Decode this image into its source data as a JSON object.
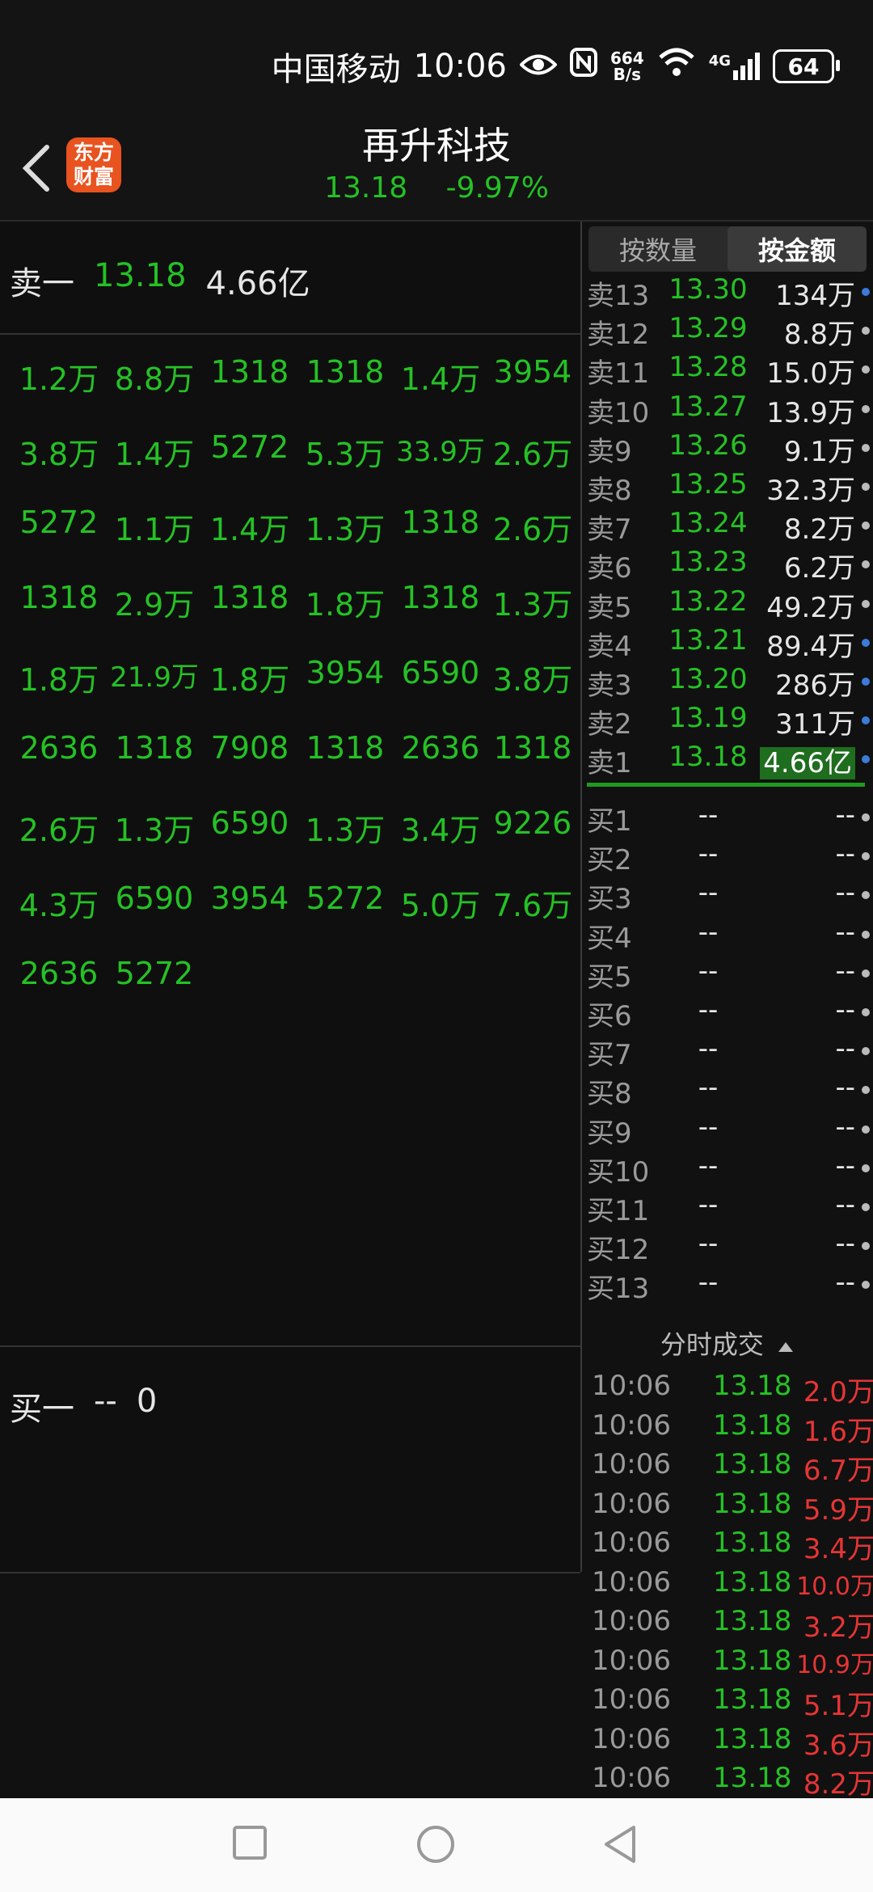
{
  "status": {
    "carrier": "中国移动",
    "time": "10:06",
    "net_speed_top": "664",
    "net_speed_bottom": "B/s",
    "signal": "4G",
    "battery": "64"
  },
  "header": {
    "title": "再升科技",
    "price": "13.18",
    "change": "-9.97%"
  },
  "sell1": {
    "label": "卖一",
    "price": "13.18",
    "amount": "4.66亿"
  },
  "buy1": {
    "label": "买一",
    "price": "--",
    "amount": "0"
  },
  "queue": [
    [
      "1.2万",
      "8.8万",
      "1318",
      "1318",
      "1.4万",
      "3954"
    ],
    [
      "3.8万",
      "1.4万",
      "5272",
      "5.3万",
      "33.9万",
      "2.6万"
    ],
    [
      "5272",
      "1.1万",
      "1.4万",
      "1.3万",
      "1318",
      "2.6万"
    ],
    [
      "1318",
      "2.9万",
      "1318",
      "1.8万",
      "1318",
      "1.3万"
    ],
    [
      "1.8万",
      "21.9万",
      "1.8万",
      "3954",
      "6590",
      "3.8万"
    ],
    [
      "2636",
      "1318",
      "7908",
      "1318",
      "2636",
      "1318"
    ],
    [
      "2.6万",
      "1.3万",
      "6590",
      "1.3万",
      "3.4万",
      "9226"
    ],
    [
      "4.3万",
      "6590",
      "3954",
      "5272",
      "5.0万",
      "7.6万"
    ],
    [
      "2636",
      "5272"
    ]
  ],
  "tabs": [
    {
      "label": "按数量",
      "active": false
    },
    {
      "label": "按金额",
      "active": true
    }
  ],
  "asks": [
    {
      "label": "卖13",
      "price": "13.30",
      "vol": "134万",
      "dot": "blue"
    },
    {
      "label": "卖12",
      "price": "13.29",
      "vol": "8.8万",
      "dot": "gray"
    },
    {
      "label": "卖11",
      "price": "13.28",
      "vol": "15.0万",
      "dot": "gray"
    },
    {
      "label": "卖10",
      "price": "13.27",
      "vol": "13.9万",
      "dot": "gray"
    },
    {
      "label": "卖9",
      "price": "13.26",
      "vol": "9.1万",
      "dot": "gray"
    },
    {
      "label": "卖8",
      "price": "13.25",
      "vol": "32.3万",
      "dot": "gray"
    },
    {
      "label": "卖7",
      "price": "13.24",
      "vol": "8.2万",
      "dot": "gray"
    },
    {
      "label": "卖6",
      "price": "13.23",
      "vol": "6.2万",
      "dot": "gray"
    },
    {
      "label": "卖5",
      "price": "13.22",
      "vol": "49.2万",
      "dot": "gray"
    },
    {
      "label": "卖4",
      "price": "13.21",
      "vol": "89.4万",
      "dot": "blue"
    },
    {
      "label": "卖3",
      "price": "13.20",
      "vol": "286万",
      "dot": "blue"
    },
    {
      "label": "卖2",
      "price": "13.19",
      "vol": "311万",
      "dot": "blue"
    },
    {
      "label": "卖1",
      "price": "13.18",
      "vol": "4.66亿",
      "dot": "blue",
      "highlight": true
    }
  ],
  "bids": [
    {
      "label": "买1",
      "price": "--",
      "vol": "--"
    },
    {
      "label": "买2",
      "price": "--",
      "vol": "--"
    },
    {
      "label": "买3",
      "price": "--",
      "vol": "--"
    },
    {
      "label": "买4",
      "price": "--",
      "vol": "--"
    },
    {
      "label": "买5",
      "price": "--",
      "vol": "--"
    },
    {
      "label": "买6",
      "price": "--",
      "vol": "--"
    },
    {
      "label": "买7",
      "price": "--",
      "vol": "--"
    },
    {
      "label": "买8",
      "price": "--",
      "vol": "--"
    },
    {
      "label": "买9",
      "price": "--",
      "vol": "--"
    },
    {
      "label": "买10",
      "price": "--",
      "vol": "--"
    },
    {
      "label": "买11",
      "price": "--",
      "vol": "--"
    },
    {
      "label": "买12",
      "price": "--",
      "vol": "--"
    },
    {
      "label": "买13",
      "price": "--",
      "vol": "--"
    }
  ],
  "trades_title": "分时成交",
  "trades": [
    {
      "time": "10:06",
      "price": "13.18",
      "vol": "2.0万"
    },
    {
      "time": "10:06",
      "price": "13.18",
      "vol": "1.6万"
    },
    {
      "time": "10:06",
      "price": "13.18",
      "vol": "6.7万"
    },
    {
      "time": "10:06",
      "price": "13.18",
      "vol": "5.9万"
    },
    {
      "time": "10:06",
      "price": "13.18",
      "vol": "3.4万"
    },
    {
      "time": "10:06",
      "price": "13.18",
      "vol": "10.0万"
    },
    {
      "time": "10:06",
      "price": "13.18",
      "vol": "3.2万"
    },
    {
      "time": "10:06",
      "price": "13.18",
      "vol": "10.9万"
    },
    {
      "time": "10:06",
      "price": "13.18",
      "vol": "5.1万"
    },
    {
      "time": "10:06",
      "price": "13.18",
      "vol": "3.6万"
    },
    {
      "time": "10:06",
      "price": "13.18",
      "vol": "8.2万"
    }
  ],
  "colors": {
    "up": "#e63535",
    "down": "#25c125",
    "bg": "#111111"
  }
}
